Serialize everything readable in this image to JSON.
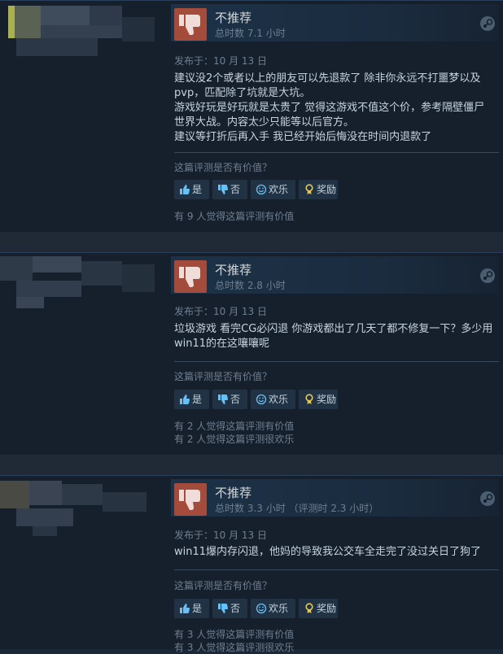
{
  "reviews": [
    {
      "recommendation": "不推荐",
      "hours": "总时数 7.1 小时",
      "posted": "发布于：10 月 13 日",
      "lines": [
        "建议没2个或者以上的朋友可以先退款了 除非你永远不打噩梦以及",
        "pvp，匹配除了坑就是大坑。",
        "游戏好玩是好玩就是太贵了 觉得这游戏不值这个价，参考隔壁僵尸",
        "世界大战。内容太少只能等以后官方。",
        "建议等打折后再入手 我已经开始后悔没在时间内退款了"
      ],
      "helpful_question": "这篇评测是否有价值？",
      "buttons": {
        "yes": "是",
        "no": "否",
        "funny": "欢乐",
        "award": "奖励"
      },
      "stats": [
        "有 9 人觉得这篇评测有价值"
      ]
    },
    {
      "recommendation": "不推荐",
      "hours": "总时数 2.8 小时",
      "posted": "发布于：10 月 13 日",
      "lines": [
        "垃圾游戏 看完CG必闪退 你游戏都出了几天了都不修复一下？多少用",
        "win11的在这嚷嚷呢"
      ],
      "helpful_question": "这篇评测是否有价值？",
      "buttons": {
        "yes": "是",
        "no": "否",
        "funny": "欢乐",
        "award": "奖励"
      },
      "stats": [
        "有 2 人觉得这篇评测有价值",
        "有 2 人觉得这篇评测很欢乐"
      ]
    },
    {
      "recommendation": "不推荐",
      "hours": "总时数 3.3 小时 （评测时 2.3 小时）",
      "posted": "发布于：10 月 13 日",
      "lines": [
        "win11爆内存闪退，他妈的导致我公交车全走完了没过关日了狗了"
      ],
      "helpful_question": "这篇评测是否有价值？",
      "buttons": {
        "yes": "是",
        "no": "否",
        "funny": "欢乐",
        "award": "奖励"
      },
      "stats": [
        "有 3 人觉得这篇评测有价值",
        "有 3 人觉得这篇评测很欢乐"
      ]
    }
  ],
  "colors": {
    "thumb_bg": "#a34c3c",
    "background": "#1b2838",
    "accent_text": "#c6d4df",
    "muted_text": "#6f7f90"
  },
  "icons": {
    "recommendation": "thumbs-down-icon",
    "platform": "steam-icon",
    "yes": "thumbs-up-icon",
    "no": "thumbs-down-icon",
    "funny": "smiley-icon",
    "award": "award-icon"
  }
}
